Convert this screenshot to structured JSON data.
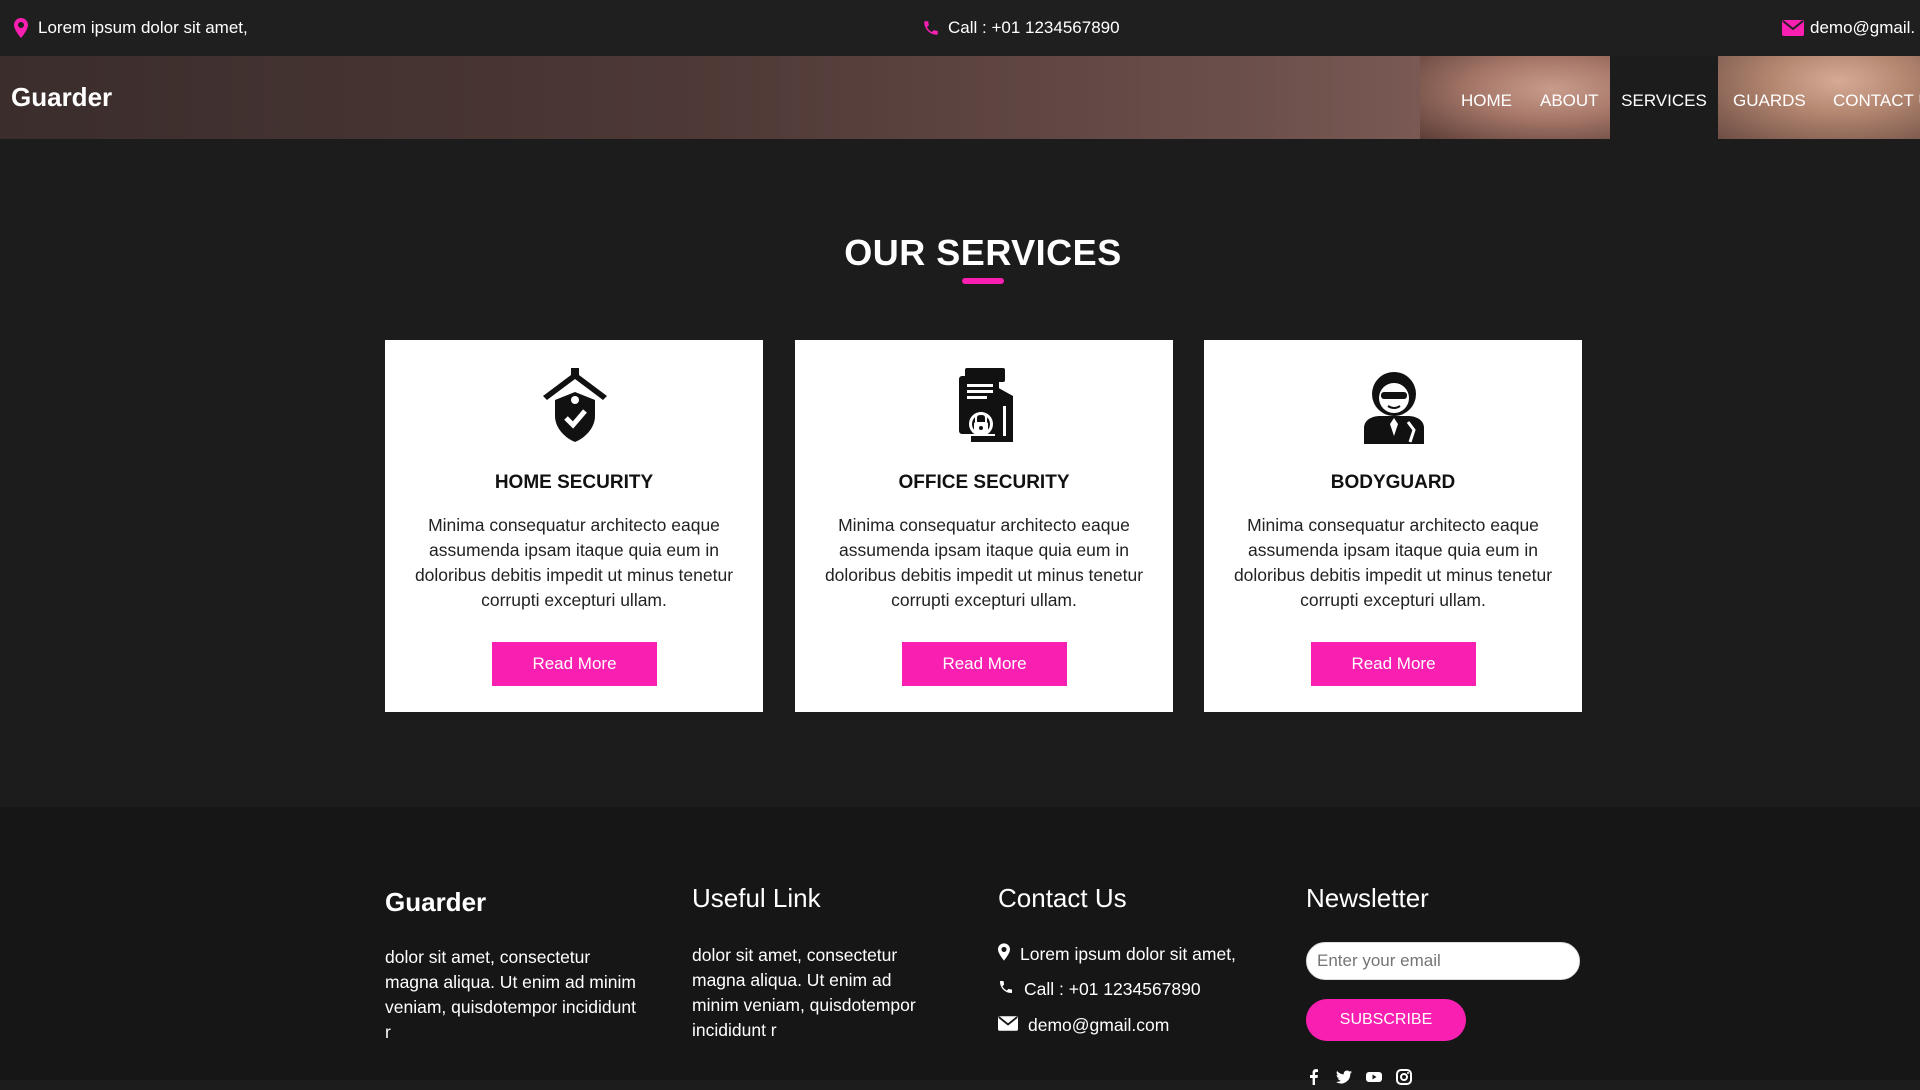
{
  "topbar": {
    "location": "Lorem ipsum dolor sit amet,",
    "call": "Call : +01 1234567890",
    "email": "demo@gmail."
  },
  "header": {
    "brand": "Guarder",
    "nav": [
      "HOME",
      "ABOUT",
      "SERVICES",
      "GUARDS",
      "CONTACT U"
    ],
    "active": "SERVICES"
  },
  "services": {
    "title": "OUR SERVICES",
    "cards": [
      {
        "icon": "home-shield-icon",
        "title": "HOME SECURITY",
        "text": "Minima consequatur architecto eaque assumenda ipsam itaque quia eum in doloribus debitis impedit ut minus tenetur corrupti excepturi ullam.",
        "button": "Read More"
      },
      {
        "icon": "document-lock-icon",
        "title": "OFFICE SECURITY",
        "text": "Minima consequatur architecto eaque assumenda ipsam itaque quia eum in doloribus debitis impedit ut minus tenetur corrupti excepturi ullam.",
        "button": "Read More"
      },
      {
        "icon": "bodyguard-icon",
        "title": "BODYGUARD",
        "text": "Minima consequatur architecto eaque assumenda ipsam itaque quia eum in doloribus debitis impedit ut minus tenetur corrupti excepturi ullam.",
        "button": "Read More"
      }
    ]
  },
  "footer": {
    "brand": "Guarder",
    "brand_text": "dolor sit amet, consectetur magna aliqua. Ut enim ad minim veniam, quisdotempor incididunt r",
    "useful_title": "Useful Link",
    "useful_text": "dolor sit amet, consectetur magna aliqua. Ut enim ad minim veniam, quisdotempor incididunt r",
    "contact_title": "Contact Us",
    "contact_location": "Lorem ipsum dolor sit amet,",
    "contact_call": "Call : +01 1234567890",
    "contact_email": "demo@gmail.com",
    "newsletter_title": "Newsletter",
    "newsletter_placeholder": "Enter your email",
    "subscribe": "SUBSCRIBE",
    "social": [
      "facebook-icon",
      "twitter-icon",
      "youtube-icon",
      "instagram-icon"
    ]
  },
  "colors": {
    "accent": "#f91fb1",
    "background": "#1c1c1c",
    "footer": "#161616"
  }
}
